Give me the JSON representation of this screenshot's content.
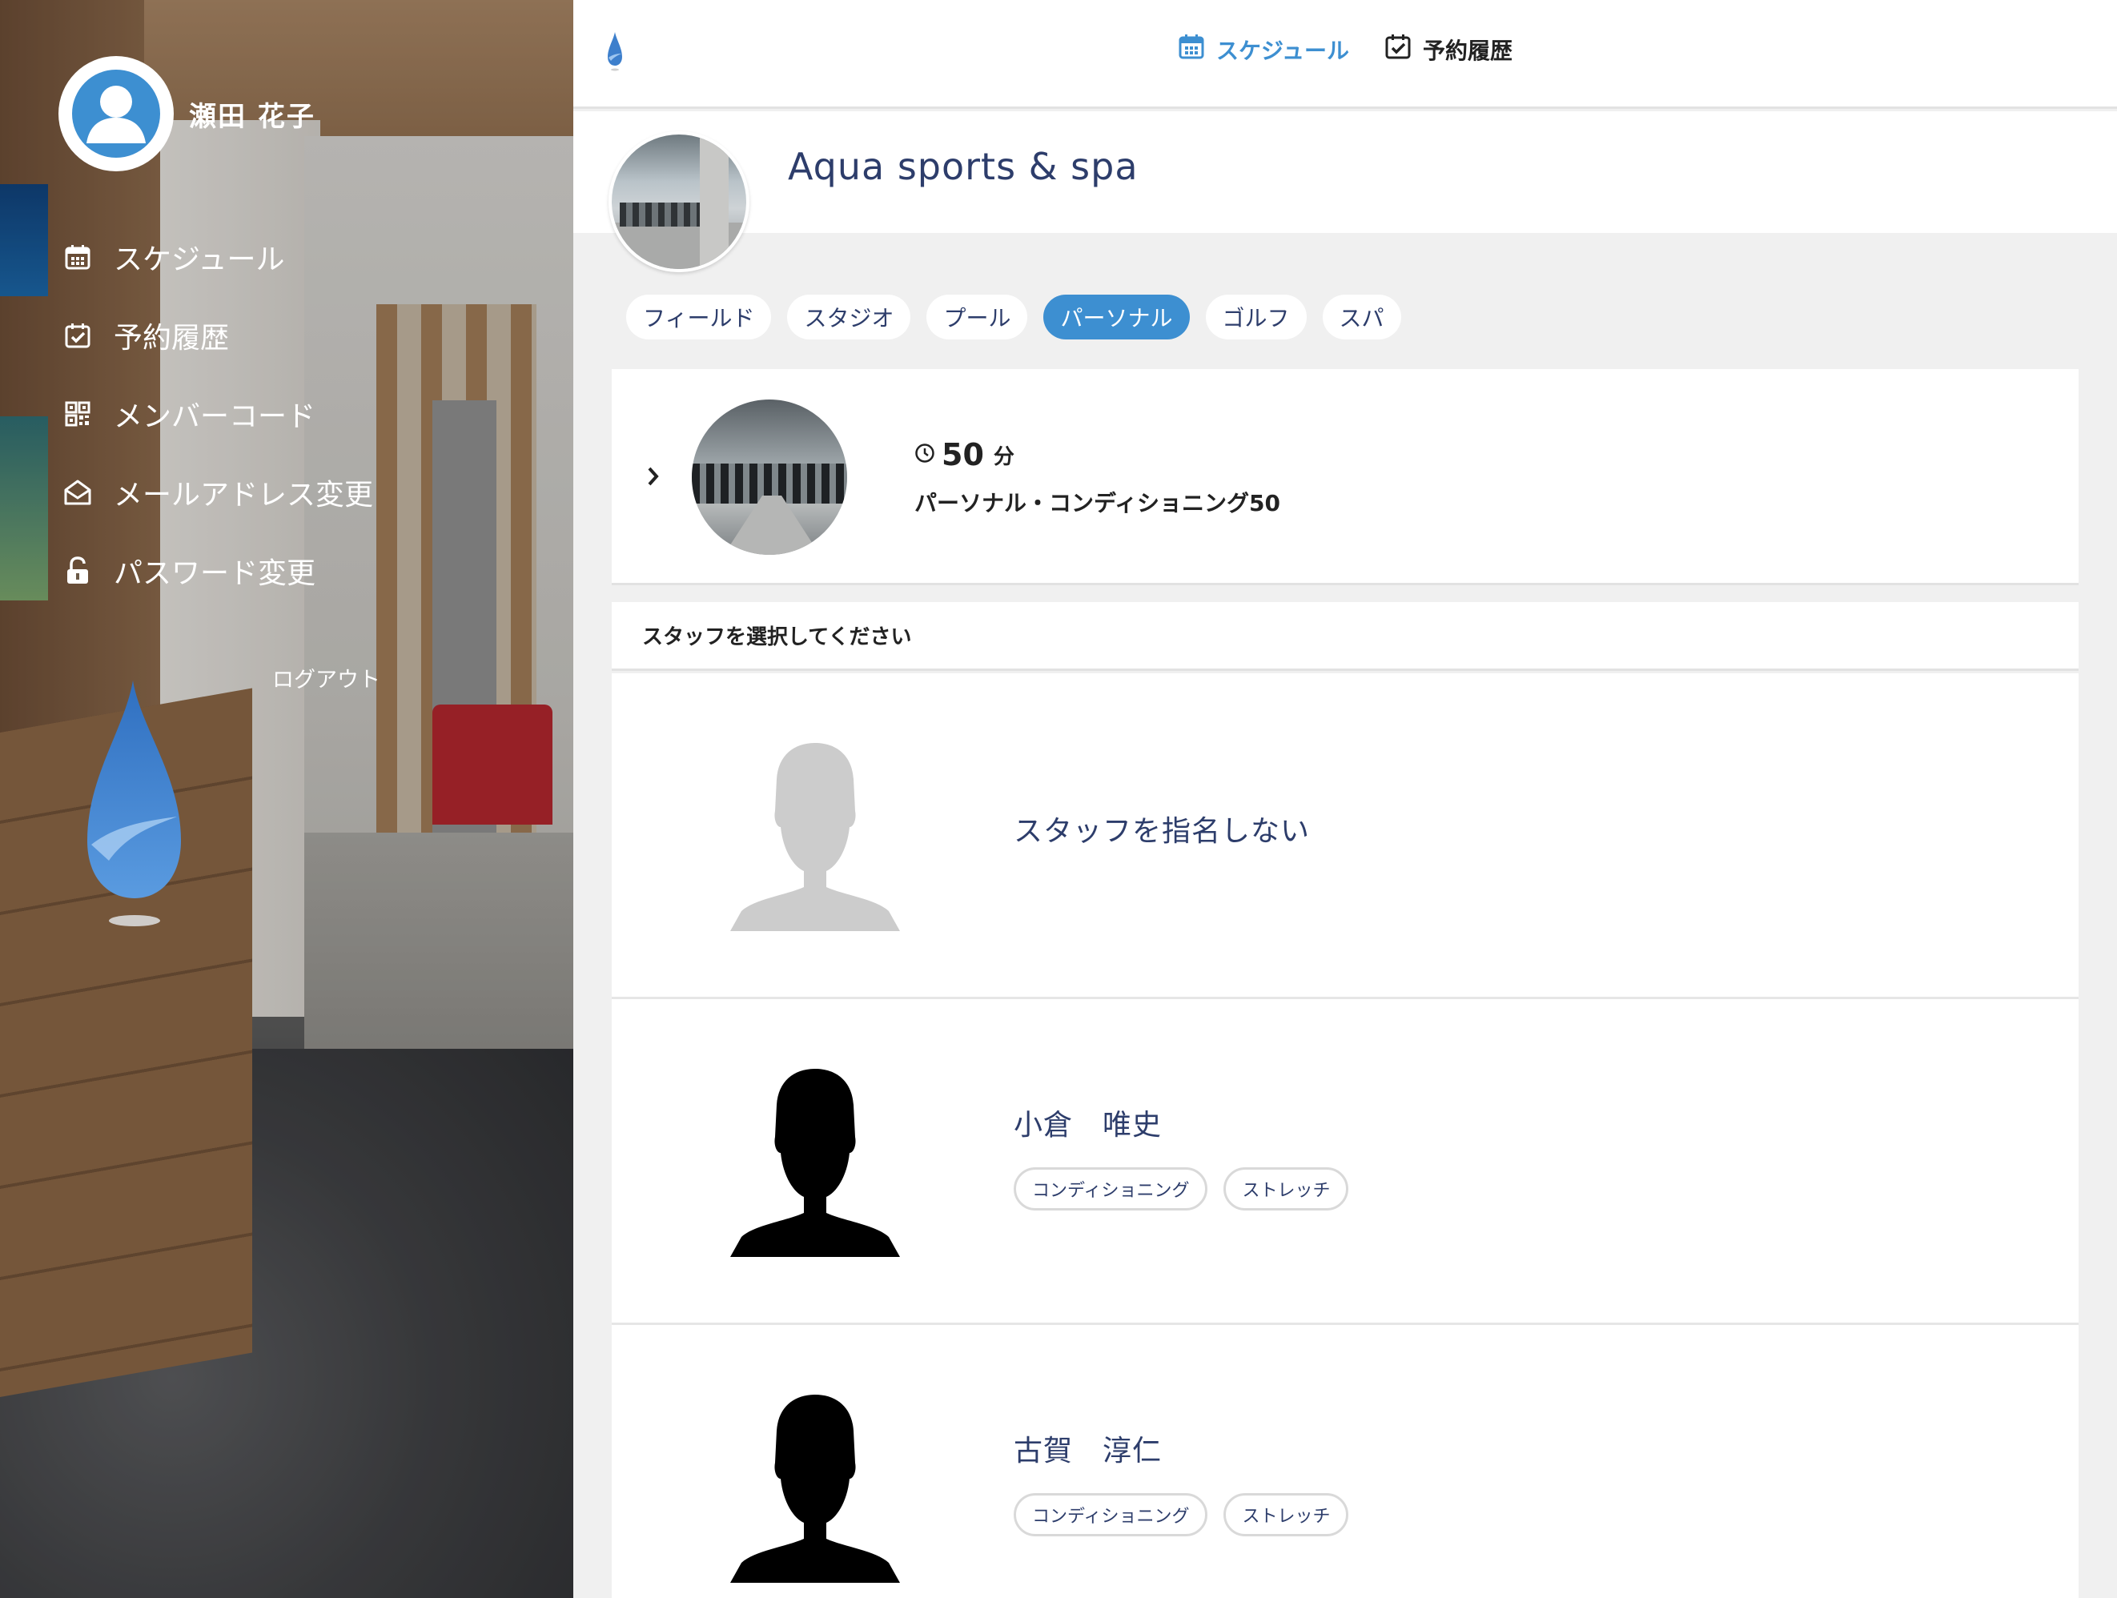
{
  "user": {
    "name": "瀬田 花子"
  },
  "sidebar": {
    "items": [
      {
        "label": "スケジュール",
        "icon": "calendar-icon"
      },
      {
        "label": "予約履歴",
        "icon": "calendar-check-icon"
      },
      {
        "label": "メンバーコード",
        "icon": "qr-code-icon"
      },
      {
        "label": "メールアドレス変更",
        "icon": "mail-open-icon"
      },
      {
        "label": "パスワード変更",
        "icon": "unlock-icon"
      }
    ],
    "logout_label": "ログアウト"
  },
  "topnav": {
    "items": [
      {
        "label": "スケジュール",
        "icon": "calendar-icon",
        "active": true
      },
      {
        "label": "予約履歴",
        "icon": "calendar-check-icon",
        "active": false
      }
    ]
  },
  "facility": {
    "name": "Aqua sports & spa"
  },
  "categories": {
    "items": [
      "フィールド",
      "スタジオ",
      "プール",
      "パーソナル",
      "ゴルフ",
      "スパ"
    ],
    "selected": "パーソナル"
  },
  "course": {
    "duration_value": "50",
    "duration_unit": "分",
    "name": "パーソナル・コンディショニング50"
  },
  "staff_section": {
    "title": "スタッフを選択してください",
    "no_preference_label": "スタッフを指名しない",
    "staff": [
      {
        "name": "小倉　唯史",
        "tags": [
          "コンディショニング",
          "ストレッチ"
        ]
      },
      {
        "name": "古賀　淳仁",
        "tags": [
          "コンディショニング",
          "ストレッチ"
        ]
      }
    ]
  },
  "colors": {
    "accent": "#3d8fd1",
    "text_navy": "#2d3d6b",
    "background": "#f0f0f0",
    "placeholder_silhouette": "#cccccc",
    "staff_silhouette": "#000000"
  }
}
